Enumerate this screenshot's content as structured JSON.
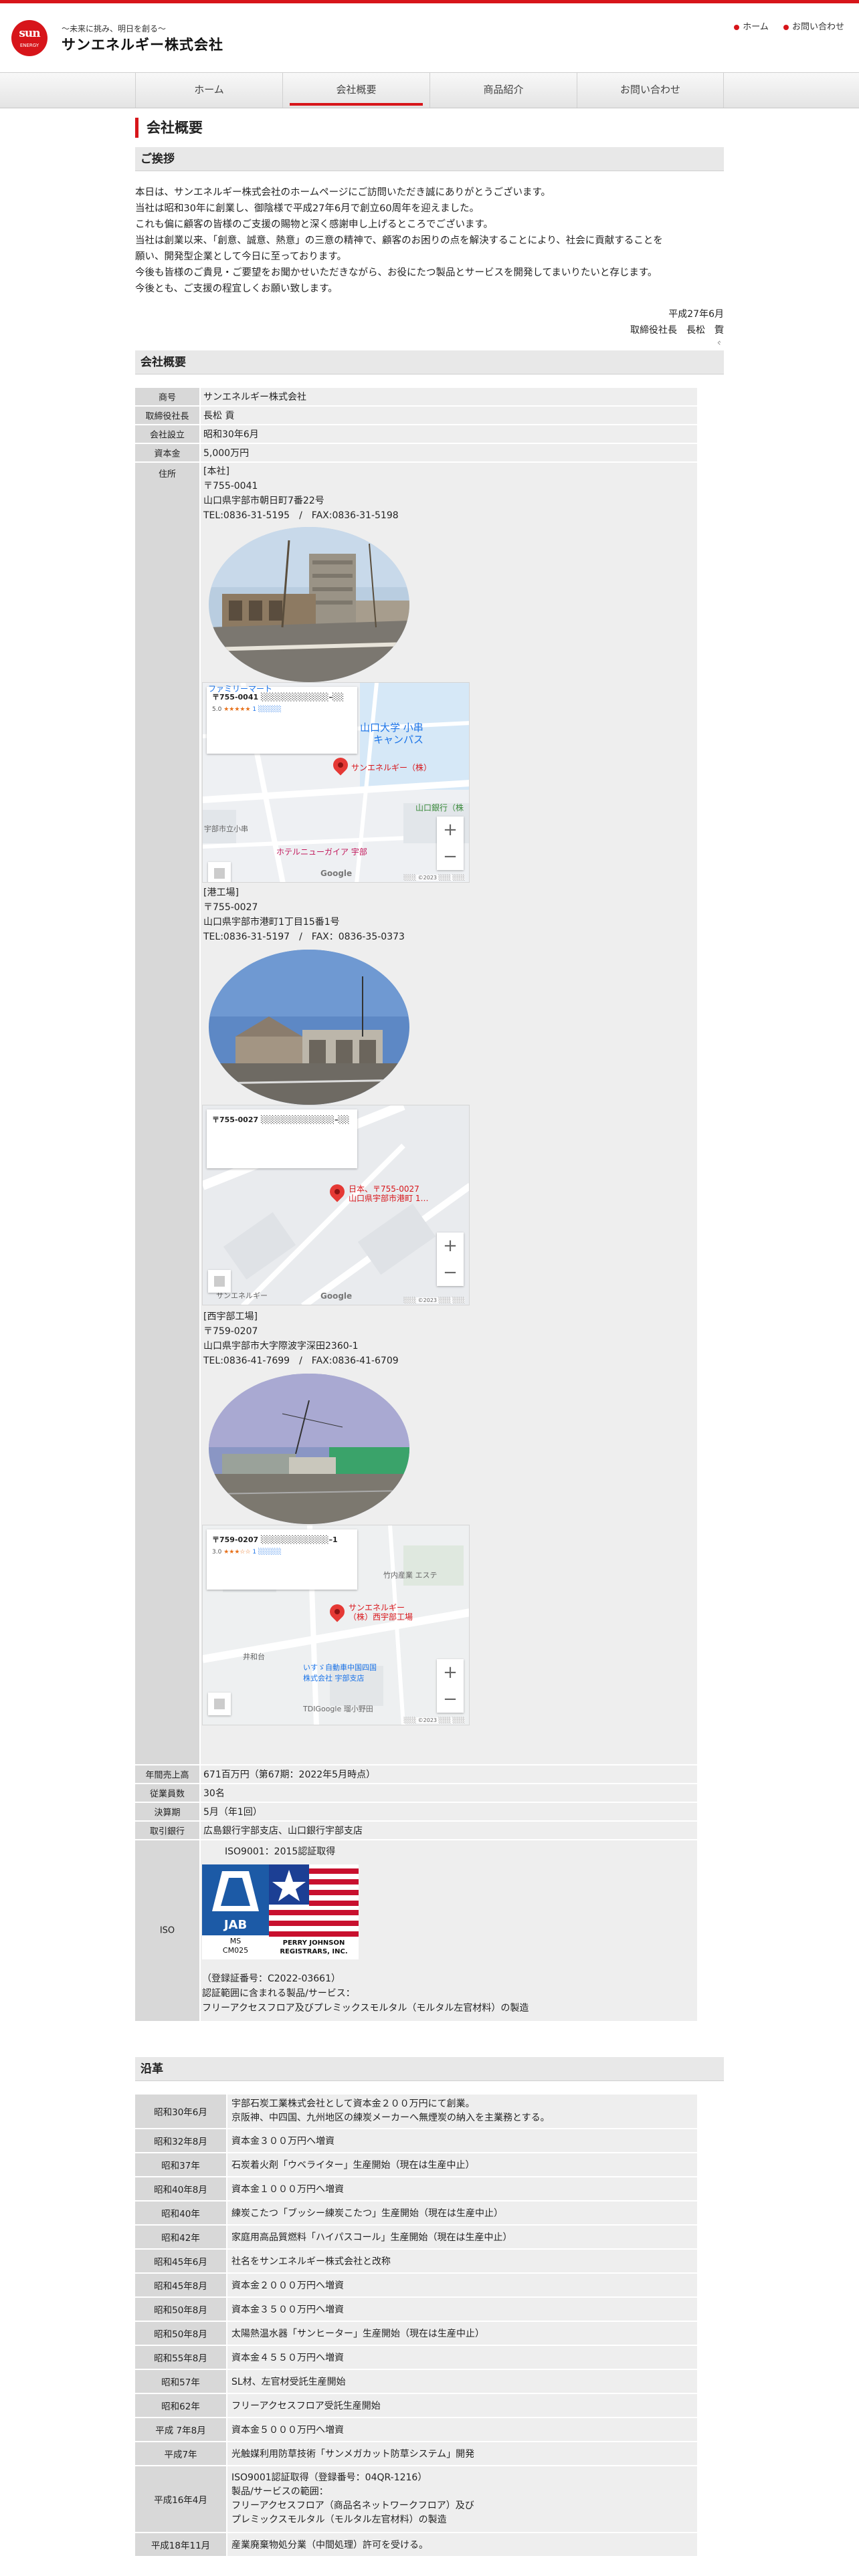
{
  "header": {
    "logo_main": "sun",
    "logo_sub": "ENERGY",
    "tagline": "〜未来に挑み、明日を創る〜",
    "company_name": "サンエネルギー株式会社",
    "top_links": [
      "ホーム",
      "お問い合わせ"
    ]
  },
  "nav": {
    "items": [
      "ホーム",
      "会社概要",
      "商品紹介",
      "お問い合わせ"
    ],
    "active": "会社概要"
  },
  "page_title": "会社概要",
  "greeting": {
    "heading": "ご挨拶",
    "lines": [
      "本日は、サンエネルギー株式会社のホームページにご訪問いただき誠にありがとうございます。",
      "当社は昭和30年に創業し、御陰様で平成27年6月で創立60周年を迎えました。",
      "これも偏に顧客の皆様のご支援の賜物と深く感謝申し上げるところでございます。",
      "当社は創業以来、「創意、誠意、熱意」の三意の精神で、顧客のお困りの点を解決することにより、社会に貢献することを",
      "願い、開発型企業として今日に至っております。",
      "今後も皆様のご貴見・ご要望をお聞かせいただきながら、お役にたつ製品とサービスを開発してまいりたいと存じます。",
      "今後とも、ご支援の程宜しくお願い致します。"
    ],
    "date": "平成27年6月",
    "signer_title": "取締役社長",
    "signer_surname": "長松",
    "signer_given": "貢",
    "signer_ruby": "みつぐ"
  },
  "overview": {
    "heading": "会社概要",
    "rows": {
      "name": {
        "label": "商号",
        "value": "サンエネルギー株式会社"
      },
      "ceo": {
        "label": "取締役社長",
        "value": "長松 貢"
      },
      "founded": {
        "label": "会社設立",
        "value": "昭和30年6月"
      },
      "capital": {
        "label": "資本金",
        "value": "5,000万円"
      },
      "address_label": "住所",
      "revenue": {
        "label": "年間売上高",
        "value": "671百万円（第67期：2022年5月時点）"
      },
      "employees": {
        "label": "従業員数",
        "value": "30名"
      },
      "fiscal": {
        "label": "決算期",
        "value": "5月（年1回）"
      },
      "banks": {
        "label": "取引銀行",
        "value": "広島銀行宇部支店、山口銀行宇部支店"
      },
      "iso": {
        "label": "ISO",
        "cert": "ISO9001：2015認証取得",
        "jab_line1": "JAB",
        "jab_line2": "MS",
        "jab_line3": "CM025",
        "pj_line1": "PERRY JOHNSON",
        "pj_line2": "REGISTRARS, INC.",
        "reg_no": "（登録証番号：C2022-03661）",
        "scope_label": "認証範囲に含まれる製品/サービス：",
        "scope": "フリーアクセスフロア及びプレミックスモルタル（モルタル左官材料）の製造"
      }
    },
    "locations": [
      {
        "name": "[本社]",
        "zip": "〒755-0041",
        "address": "山口県宇部市朝日町7番22号",
        "tel": "TEL:0836-31-5195　/　FAX:0836-31-5198",
        "map_info_addr": "〒755-0041 ░░░░░░░░░░░░–░░",
        "map_rating": "5.0",
        "map_stars": "★★★★★",
        "map_reviews": "1 ░░░░░",
        "map_place_main": "山口大学 小串",
        "map_place_sub": "キャンパス",
        "map_pin_label": "サンエネルギー（株）",
        "map_label_a": "ファミリーマート",
        "map_label_b": "ホテルニューガイア 宇部",
        "map_label_c": "山口銀行（株",
        "map_label_d": "宇部市立小串",
        "map_label_e": "キャンパス"
      },
      {
        "name": "[港工場]",
        "zip": "〒755-0027",
        "address": "山口県宇部市港町1丁目15番1号",
        "tel": "TEL:0836-31-5197　/　FAX：0836-35-0373",
        "map_info_addr": "〒755-0027 ░░░░░░░░░░░░░–░░",
        "map_pin_label": "日本、〒755-0027",
        "map_pin_label2": "山口県宇部市港町 1…",
        "map_label_a": "サンエネルギー"
      },
      {
        "name": "[西宇部工場]",
        "zip": "〒759-0207",
        "address": "山口県宇部市大字際波字深田2360-1",
        "tel": "TEL:0836-41-7699　/　FAX:0836-41-6709",
        "map_info_addr": "〒759-0207 ░░░░░░░░░░░░–1",
        "map_rating": "3.0",
        "map_stars": "★★★☆☆",
        "map_reviews": "1 ░░░░░",
        "map_pin_label": "サンエネルギー",
        "map_pin_label2": "（株）西宇部工場",
        "map_label_a": "竹内産業 エステ",
        "map_label_b": "いすゞ自動車中国四国",
        "map_label_c": "株式会社 宇部支店",
        "map_label_d": "井和台",
        "map_label_e": "TDIGoogle 瑠小野田"
      }
    ],
    "map_copyright": "░░░ ©2023 ░░░ ░░░",
    "google": "Google"
  },
  "history": {
    "heading": "沿革",
    "rows": [
      {
        "date": "昭和30年6月",
        "text": [
          "宇部石炭工業株式会社として資本金２００万円にて創業。",
          "京阪神、中四国、九州地区の練炭メーカーへ無煙炭の納入を主業務とする。"
        ]
      },
      {
        "date": "昭和32年8月",
        "text": [
          "資本金３００万円へ増資"
        ]
      },
      {
        "date": "昭和37年",
        "text": [
          "石炭着火剤「ウベライター」生産開始（現在は生産中止）"
        ]
      },
      {
        "date": "昭和40年8月",
        "text": [
          "資本金１０００万円へ増資"
        ]
      },
      {
        "date": "昭和40年",
        "text": [
          "練炭こたつ「ブッシー練炭こたつ」生産開始（現在は生産中止）"
        ]
      },
      {
        "date": "昭和42年",
        "text": [
          "家庭用高品質燃料「ハイパスコール」生産開始（現在は生産中止）"
        ]
      },
      {
        "date": "昭和45年6月",
        "text": [
          "社名をサンエネルギー株式会社と改称"
        ]
      },
      {
        "date": "昭和45年8月",
        "text": [
          "資本金２０００万円へ増資"
        ]
      },
      {
        "date": "昭和50年8月",
        "text": [
          "資本金３５００万円へ増資"
        ]
      },
      {
        "date": "昭和50年8月",
        "text": [
          "太陽熱温水器「サンヒーター」生産開始（現在は生産中止）"
        ]
      },
      {
        "date": "昭和55年8月",
        "text": [
          "資本金４５５０万円へ増資"
        ]
      },
      {
        "date": "昭和57年",
        "text": [
          "SL材、左官材受託生産開始"
        ]
      },
      {
        "date": "昭和62年",
        "text": [
          "フリーアクセスフロア受託生産開始"
        ]
      },
      {
        "date": "平成 7年8月",
        "text": [
          "資本金５０００万円へ増資"
        ]
      },
      {
        "date": "平成7年",
        "text": [
          "光触媒利用防草技術「サンメガカット防草システム」開発"
        ]
      },
      {
        "date": "平成16年4月",
        "text": [
          "ISO9001認証取得（登録番号：04QR-1216）",
          "製品/サービスの範囲：",
          "フリーアクセスフロア（商品名ネットワークフロア）及び",
          "プレミックスモルタル（モルタル左官材料）の製造"
        ]
      },
      {
        "date": "平成18年11月",
        "text": [
          "産業廃棄物処分業（中間処理）許可を受ける。"
        ]
      }
    ]
  },
  "colors": {
    "accent": "#d7151a",
    "header_bg": "#e8e8e8",
    "table_th": "#d8d8d8",
    "table_td": "#eeeeee"
  }
}
